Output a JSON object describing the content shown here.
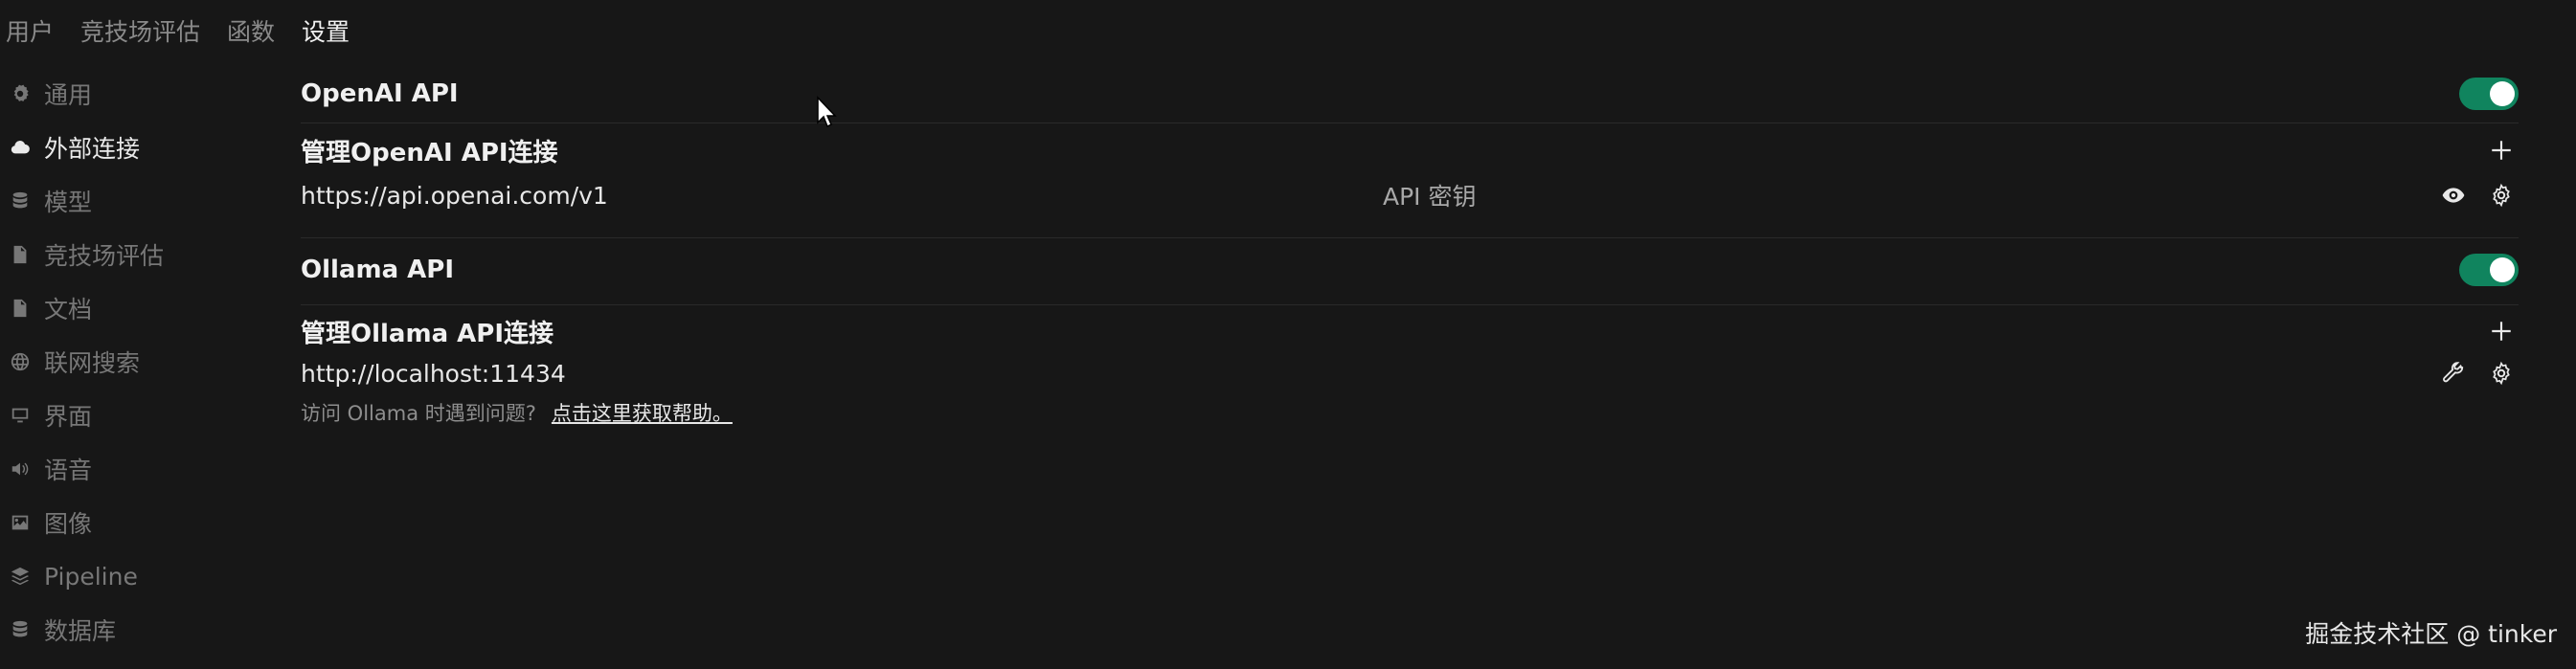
{
  "top_tabs": [
    {
      "label": "用户"
    },
    {
      "label": "竞技场评估"
    },
    {
      "label": "函数"
    },
    {
      "label": "设置"
    }
  ],
  "sidebar": {
    "items": [
      {
        "label": "通用",
        "icon": "gear-icon"
      },
      {
        "label": "外部连接",
        "icon": "cloud-icon"
      },
      {
        "label": "模型",
        "icon": "database-icon"
      },
      {
        "label": "竞技场评估",
        "icon": "document-icon"
      },
      {
        "label": "文档",
        "icon": "document-icon"
      },
      {
        "label": "联网搜索",
        "icon": "globe-icon"
      },
      {
        "label": "界面",
        "icon": "monitor-icon"
      },
      {
        "label": "语音",
        "icon": "speaker-icon"
      },
      {
        "label": "图像",
        "icon": "image-icon"
      },
      {
        "label": "Pipeline",
        "icon": "layers-icon"
      },
      {
        "label": "数据库",
        "icon": "database-icon"
      }
    ]
  },
  "openai": {
    "title": "OpenAI API",
    "enabled": true,
    "manage_title": "管理OpenAI API连接",
    "url": "https://api.openai.com/v1",
    "key_label": "API 密钥"
  },
  "ollama": {
    "title": "Ollama API",
    "enabled": true,
    "manage_title": "管理Ollama API连接",
    "url": "http://localhost:11434",
    "help_text": "访问 Ollama 时遇到问题?",
    "help_link": "点击这里获取帮助。"
  },
  "watermark": "掘金技术社区 @ tinker",
  "colors": {
    "background": "#171717",
    "toggle_on": "#10845e"
  }
}
